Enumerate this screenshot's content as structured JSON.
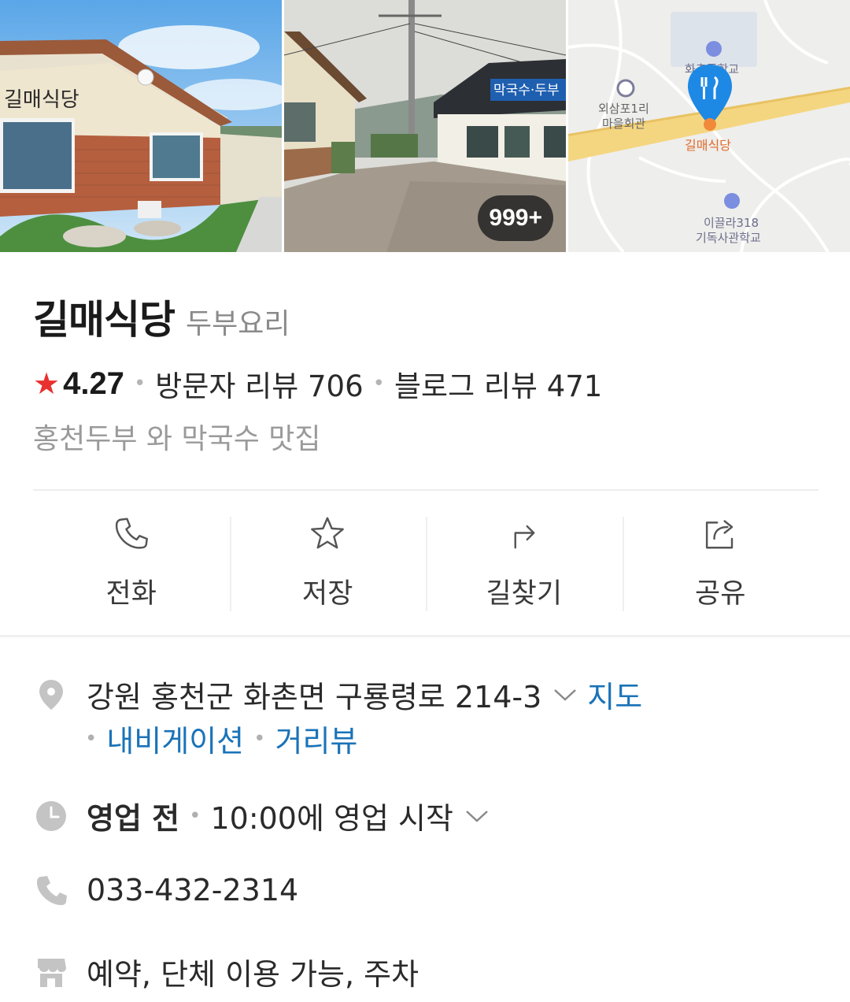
{
  "gallery": {
    "photo_count_badge": "999+",
    "sign_text": "막국수·두부",
    "building_sign": "길매식당",
    "map_labels": {
      "school_top": "화촌중학교",
      "hall": "외삼포1리 마을회관",
      "hall_line1": "외삼포1리",
      "hall_line2": "마을회관",
      "restaurant": "길매식당",
      "church_school_line1": "이끌라318",
      "church_school_line2": "기독사관학교"
    }
  },
  "place": {
    "name": "길매식당",
    "category": "두부요리",
    "rating": "4.27",
    "visitor_reviews": "방문자 리뷰 706",
    "blog_reviews": "블로그 리뷰 471",
    "description": "홍천두부 와 막국수 맛집"
  },
  "actions": [
    {
      "label": "전화",
      "icon": "phone-icon"
    },
    {
      "label": "저장",
      "icon": "star-icon"
    },
    {
      "label": "길찾기",
      "icon": "directions-icon"
    },
    {
      "label": "공유",
      "icon": "share-icon"
    }
  ],
  "info": {
    "address": "강원 홍천군 화촌면 구룡령로 214-3",
    "map_link": "지도",
    "navigation_link": "내비게이션",
    "streetview_link": "거리뷰",
    "status": "영업 전",
    "hours": "10:00에 영업 시작",
    "phone": "033-432-2314",
    "amenities": "예약, 단체 이용 가능, 주차"
  },
  "colors": {
    "star": "#e8312f",
    "link_blue": "#1a73b8",
    "map_pin": "#1e88e5",
    "icon_grey": "#c4c4c4"
  }
}
